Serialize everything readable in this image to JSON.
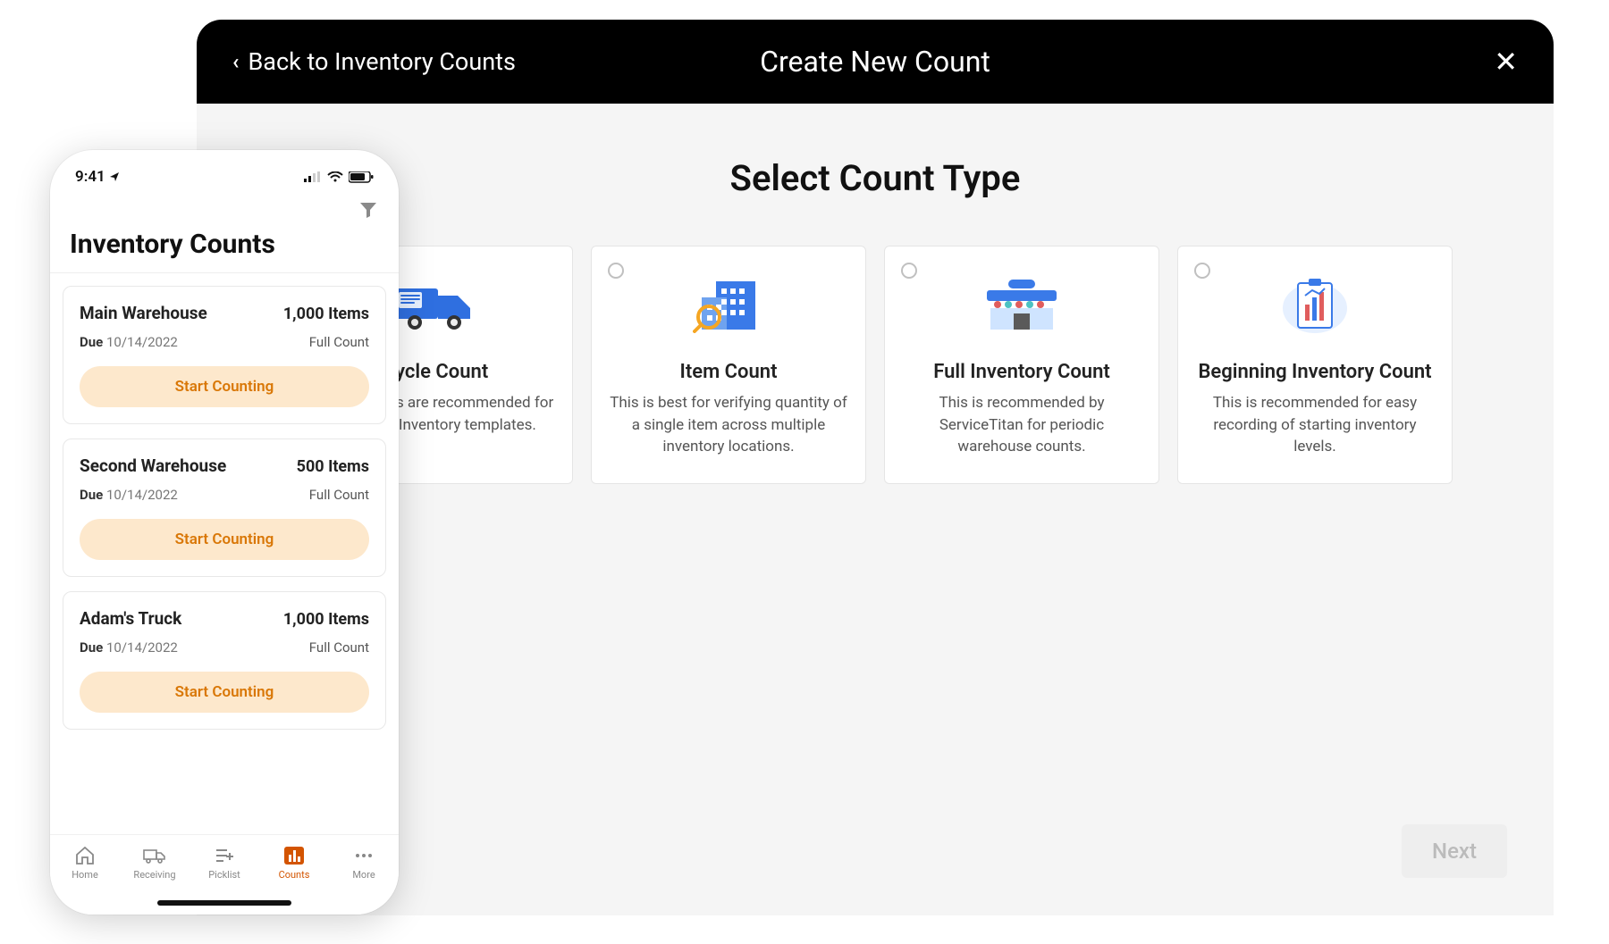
{
  "modal": {
    "back_label": "Back to Inventory Counts",
    "title": "Create New Count",
    "section_title": "Select Count Type",
    "next_label": "Next"
  },
  "cards": [
    {
      "title": "Cycle Count",
      "desc": "Cycle counts are recommended for recurring Inventory templates."
    },
    {
      "title": "Item Count",
      "desc": "This is best for verifying quantity of a single item across multiple inventory locations."
    },
    {
      "title": "Full Inventory Count",
      "desc": "This is recommended by ServiceTitan for periodic warehouse counts."
    },
    {
      "title": "Beginning Inventory Count",
      "desc": "This is recommended for easy recording of starting inventory levels."
    }
  ],
  "phone": {
    "status_time": "9:41",
    "page_title": "Inventory Counts",
    "due_label": "Due",
    "start_label": "Start Counting",
    "items_suffix": "Items"
  },
  "inventory": [
    {
      "name": "Main Warehouse",
      "items": "1,000 Items",
      "due": "10/14/2022",
      "type": "Full Count"
    },
    {
      "name": "Second Warehouse",
      "items": "500 Items",
      "due": "10/14/2022",
      "type": "Full Count"
    },
    {
      "name": "Adam's Truck",
      "items": "1,000 Items",
      "due": "10/14/2022",
      "type": "Full Count"
    }
  ],
  "tabs": [
    {
      "label": "Home"
    },
    {
      "label": "Receiving"
    },
    {
      "label": "Picklist"
    },
    {
      "label": "Counts"
    },
    {
      "label": "More"
    }
  ]
}
